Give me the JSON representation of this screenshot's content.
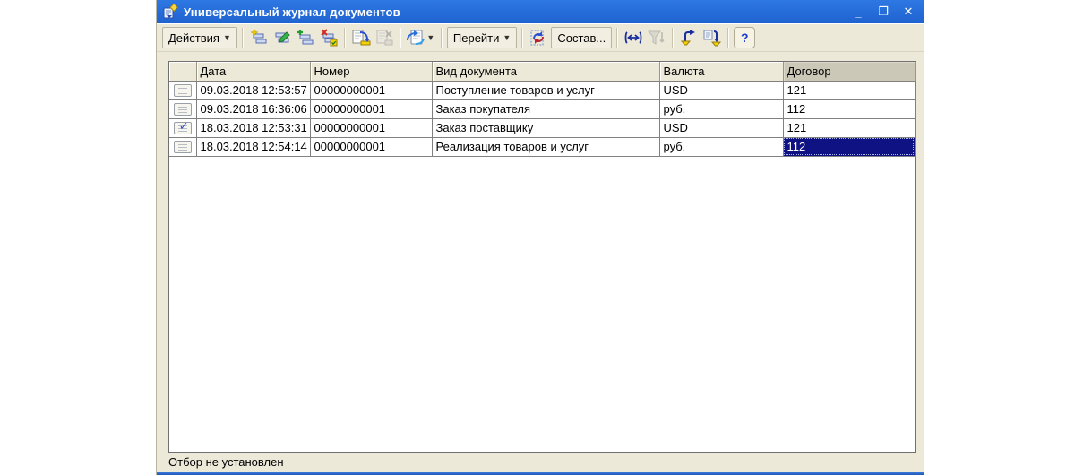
{
  "window": {
    "title": "Универсальный журнал документов",
    "controls": {
      "minimize": "_",
      "maximize": "❐",
      "close": "✕"
    }
  },
  "toolbar": {
    "actions_label": "Действия",
    "goto_label": "Перейти",
    "compose_label": "Состав...",
    "help_label": "?",
    "caret": "▼",
    "icons": [
      "add-row-icon",
      "edit-row-icon",
      "copy-row-icon",
      "delete-row-icon",
      "post-document-icon",
      "unpost-document-icon",
      "enter-on-basis-icon",
      "refresh-icon",
      "column-width-icon",
      "filter-settings-icon",
      "filter-by-value-icon",
      "filter-history-icon",
      "help-icon"
    ],
    "colors": {
      "accent_blue": "#1a3fd0",
      "accent_red": "#c42b1c",
      "accent_green": "#1f9d2f",
      "accent_yellow": "#f2d200"
    }
  },
  "table": {
    "columns": [
      "",
      "Дата",
      "Номер",
      "Вид документа",
      "Валюта",
      "Договор"
    ],
    "rows": [
      {
        "posted": false,
        "date": "09.03.2018 12:53:57",
        "number": "00000000001",
        "type": "Поступление товаров и услуг",
        "currency": "USD",
        "contract": "121"
      },
      {
        "posted": false,
        "date": "09.03.2018 16:36:06",
        "number": "00000000001",
        "type": "Заказ покупателя",
        "currency": "руб.",
        "contract": "112"
      },
      {
        "posted": true,
        "date": "18.03.2018 12:53:31",
        "number": "00000000001",
        "type": "Заказ поставщику",
        "currency": "USD",
        "contract": "121"
      },
      {
        "posted": false,
        "date": "18.03.2018 12:54:14",
        "number": "00000000001",
        "type": "Реализация товаров и услуг",
        "currency": "руб.",
        "contract": "112"
      }
    ],
    "selection": {
      "row_index": 3,
      "column": "Договор",
      "value": "112",
      "selection_color": "#0f1283"
    }
  },
  "statusbar": {
    "text": "Отбор не установлен"
  },
  "colors": {
    "titlebar": "#2268d6",
    "panel": "#ece9d8",
    "grid_line": "#808080",
    "header_current": "#ccc8b8"
  }
}
